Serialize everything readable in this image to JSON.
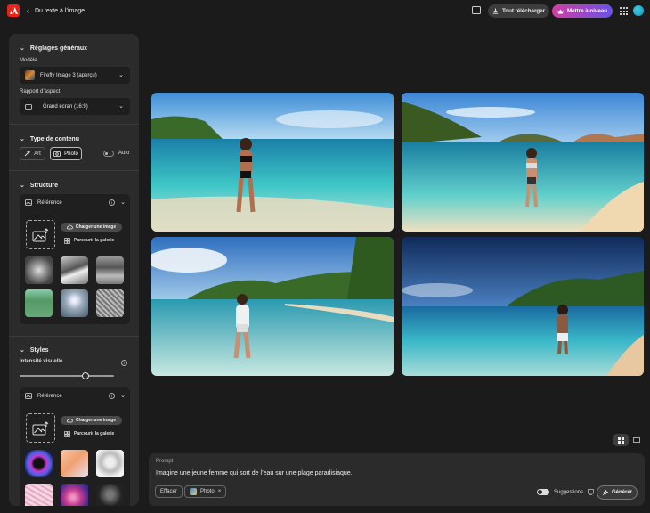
{
  "topbar": {
    "back_label": "Du texte à l’image",
    "download_label": "Tout télécharger",
    "upgrade_label": "Mettre à niveau"
  },
  "panel": {
    "general": {
      "title": "Réglages généraux",
      "model_label": "Modèle",
      "model_value": "Firefly Image 3 (aperçu)",
      "ratio_label": "Rapport d’aspect",
      "ratio_value": "Grand écran (16:9)"
    },
    "content_type": {
      "title": "Type de contenu",
      "art_label": "Art",
      "photo_label": "Photo",
      "auto_label": "Auto",
      "selected": "Photo"
    },
    "structure": {
      "title": "Structure",
      "ref_title": "Référence",
      "upload_label": "Charger une image",
      "browse_label": "Parcourir la galerie"
    },
    "styles": {
      "title": "Styles",
      "intensity_label": "Intensité visuelle",
      "intensity_value": 0.7,
      "ref_title": "Référence",
      "upload_label": "Charger une image",
      "browse_label": "Parcourir la galerie"
    }
  },
  "prompt": {
    "label": "Prompt",
    "text": "Imagine une jeune femme qui sort de l’eau sur une plage paradisiaque.",
    "clear_label": "Effacer",
    "chip_label": "Photo",
    "chip_close": "×",
    "suggestions_label": "Suggestions",
    "generate_label": "Générer"
  },
  "colors": {
    "logo": "#e8231a",
    "upgrade_gradient_start": "#d13ea3",
    "upgrade_gradient_end": "#6a52e8",
    "panel": "#2b2b2b",
    "background": "#1b1b1b"
  },
  "icons": [
    "adobe-logo-icon",
    "chevron-left-icon",
    "feedback-icon",
    "download-icon",
    "sparkle-icon",
    "apps-grid-icon",
    "chevron-down-icon",
    "brush-icon",
    "camera-icon",
    "image-upload-icon",
    "cloud-upload-icon",
    "gallery-icon",
    "info-icon",
    "grid-view-icon",
    "single-view-icon",
    "generate-icon"
  ]
}
